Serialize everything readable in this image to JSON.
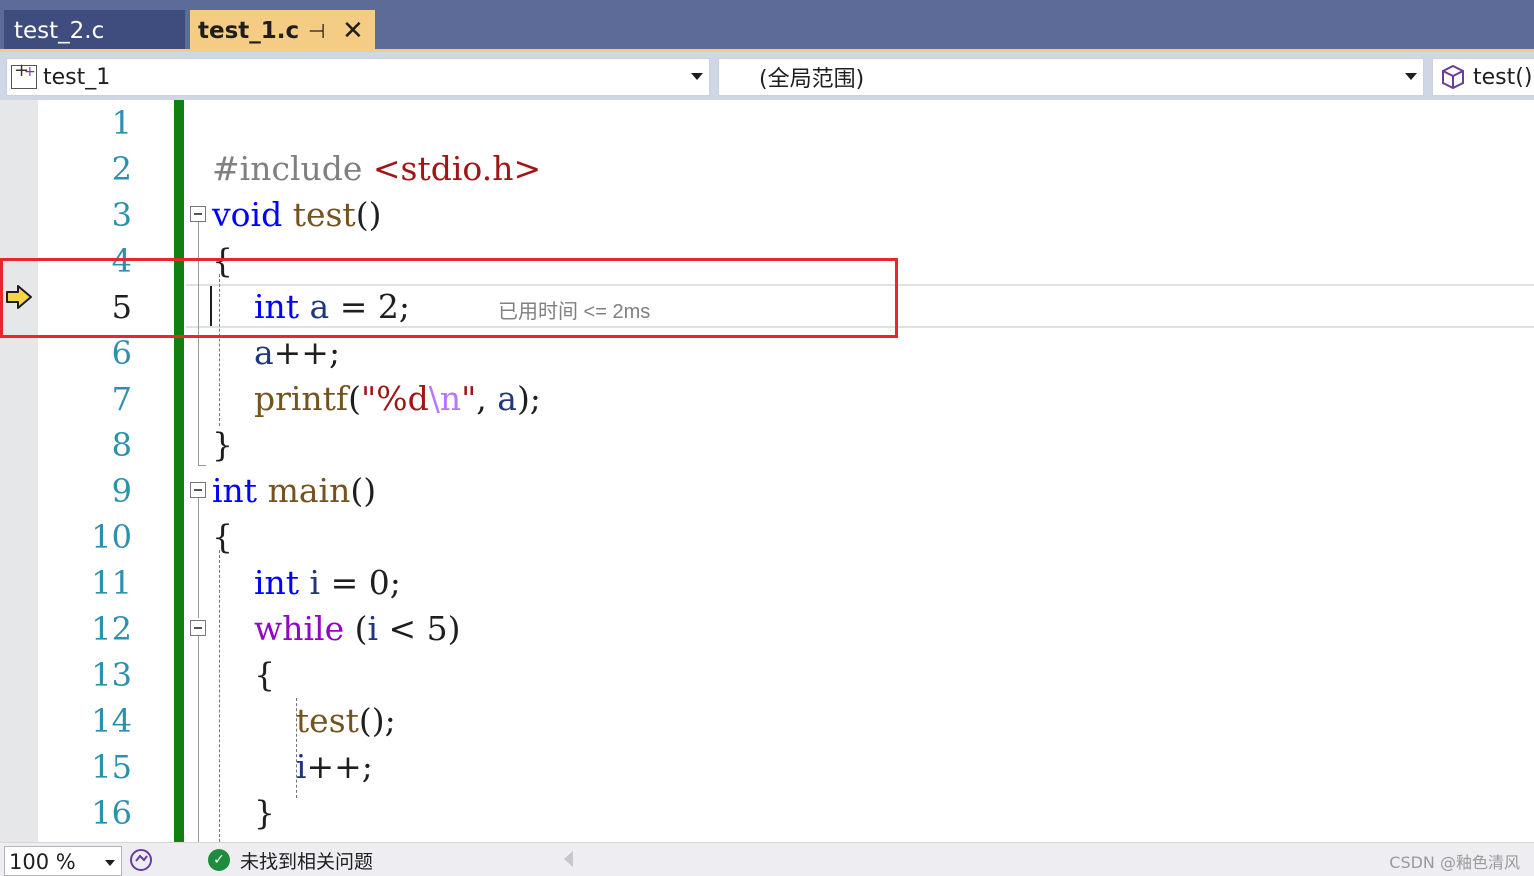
{
  "tabs": [
    {
      "label": "test_2.c",
      "active": false
    },
    {
      "label": "test_1.c",
      "active": true
    }
  ],
  "active_tab_icons": {
    "pin": "pin-icon",
    "close": "close-icon"
  },
  "nav": {
    "project": "test_1",
    "scope": "(全局范围)",
    "function": "test()"
  },
  "editor": {
    "line_numbers": [
      "1",
      "2",
      "3",
      "4",
      "5",
      "6",
      "7",
      "8",
      "9",
      "10",
      "11",
      "12",
      "13",
      "14",
      "15",
      "16"
    ],
    "current_line": "5",
    "lines": [
      {
        "parts": []
      },
      {
        "parts": [
          {
            "t": "#include ",
            "c": "pre"
          },
          {
            "t": "<stdio.h>",
            "c": "str"
          }
        ]
      },
      {
        "parts": [
          {
            "t": "void",
            "c": "kw"
          },
          {
            "t": " ",
            "c": ""
          },
          {
            "t": "test",
            "c": "fn"
          },
          {
            "t": "()",
            "c": ""
          }
        ]
      },
      {
        "parts": [
          {
            "t": "{",
            "c": ""
          }
        ]
      },
      {
        "parts": [
          {
            "t": "    ",
            "c": ""
          },
          {
            "t": "int",
            "c": "kw"
          },
          {
            "t": " ",
            "c": ""
          },
          {
            "t": "a",
            "c": "var"
          },
          {
            "t": " = 2;",
            "c": ""
          }
        ]
      },
      {
        "parts": [
          {
            "t": "    ",
            "c": ""
          },
          {
            "t": "a",
            "c": "var"
          },
          {
            "t": "++;",
            "c": ""
          }
        ]
      },
      {
        "parts": [
          {
            "t": "    ",
            "c": ""
          },
          {
            "t": "printf",
            "c": "fn"
          },
          {
            "t": "(",
            "c": ""
          },
          {
            "t": "\"%d",
            "c": "str"
          },
          {
            "t": "\\n",
            "c": "esc"
          },
          {
            "t": "\"",
            "c": "str"
          },
          {
            "t": ", ",
            "c": ""
          },
          {
            "t": "a",
            "c": "var"
          },
          {
            "t": ");",
            "c": ""
          }
        ]
      },
      {
        "parts": [
          {
            "t": "}",
            "c": ""
          }
        ]
      },
      {
        "parts": [
          {
            "t": "int",
            "c": "kw"
          },
          {
            "t": " ",
            "c": ""
          },
          {
            "t": "main",
            "c": "fn"
          },
          {
            "t": "()",
            "c": ""
          }
        ]
      },
      {
        "parts": [
          {
            "t": "{",
            "c": ""
          }
        ]
      },
      {
        "parts": [
          {
            "t": "    ",
            "c": ""
          },
          {
            "t": "int",
            "c": "kw"
          },
          {
            "t": " ",
            "c": ""
          },
          {
            "t": "i",
            "c": "var"
          },
          {
            "t": " = 0;",
            "c": ""
          }
        ]
      },
      {
        "parts": [
          {
            "t": "    ",
            "c": ""
          },
          {
            "t": "while",
            "c": "kw2"
          },
          {
            "t": " (",
            "c": ""
          },
          {
            "t": "i",
            "c": "var"
          },
          {
            "t": " < 5)",
            "c": ""
          }
        ]
      },
      {
        "parts": [
          {
            "t": "    {",
            "c": ""
          }
        ]
      },
      {
        "parts": [
          {
            "t": "        ",
            "c": ""
          },
          {
            "t": "test",
            "c": "fn"
          },
          {
            "t": "();",
            "c": ""
          }
        ]
      },
      {
        "parts": [
          {
            "t": "        ",
            "c": ""
          },
          {
            "t": "i",
            "c": "var"
          },
          {
            "t": "++;",
            "c": ""
          }
        ]
      },
      {
        "parts": [
          {
            "t": "    }",
            "c": ""
          }
        ]
      }
    ],
    "perf_tip": "已用时间 <= 2ms"
  },
  "status": {
    "zoom": "100 %",
    "issues": "未找到相关问题",
    "watermark": "CSDN @釉色清风"
  }
}
